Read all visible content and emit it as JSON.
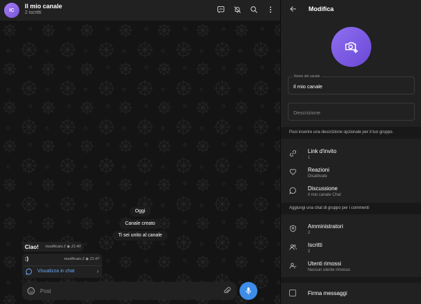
{
  "chat": {
    "avatar_initials": "IC",
    "title": "Il mio canale",
    "subtitle": "2 iscritti",
    "service": {
      "date": "Oggi",
      "created": "Canale creato",
      "joined": "Ti sei unito al canale"
    },
    "messages": [
      {
        "text": "Ciao!",
        "edited": "modificato",
        "views": "2",
        "time": "21:40"
      },
      {
        "text": ":)",
        "edited": "modificato",
        "views": "2",
        "time": "21:47",
        "action": "Visualizza in chat"
      }
    ],
    "composer_placeholder": "Post"
  },
  "panel": {
    "title": "Modifica",
    "name_label": "Nome del canale",
    "name_value": "Il mio canale",
    "description_placeholder": "Descrizione",
    "description_hint": "Puoi inserire una descrizione opzionale per il tuo gruppo.",
    "group_hint": "Aggiungi una chat di gruppo per i commenti",
    "items": [
      {
        "title": "Link d'invito",
        "sub": "1"
      },
      {
        "title": "Reazioni",
        "sub": "Disattivate"
      },
      {
        "title": "Discussione",
        "sub": "Il mio canale Chat"
      },
      {
        "title": "Amministratori",
        "sub": "2"
      },
      {
        "title": "Iscritti",
        "sub": "2"
      },
      {
        "title": "Utenti rimossi",
        "sub": "Nessun utente rimosso"
      }
    ],
    "sign_messages": "Firma messaggi"
  },
  "colors": {
    "accent": "#3d8ce8",
    "avatar": "#8f6ff0",
    "link": "#6aaaf2"
  }
}
